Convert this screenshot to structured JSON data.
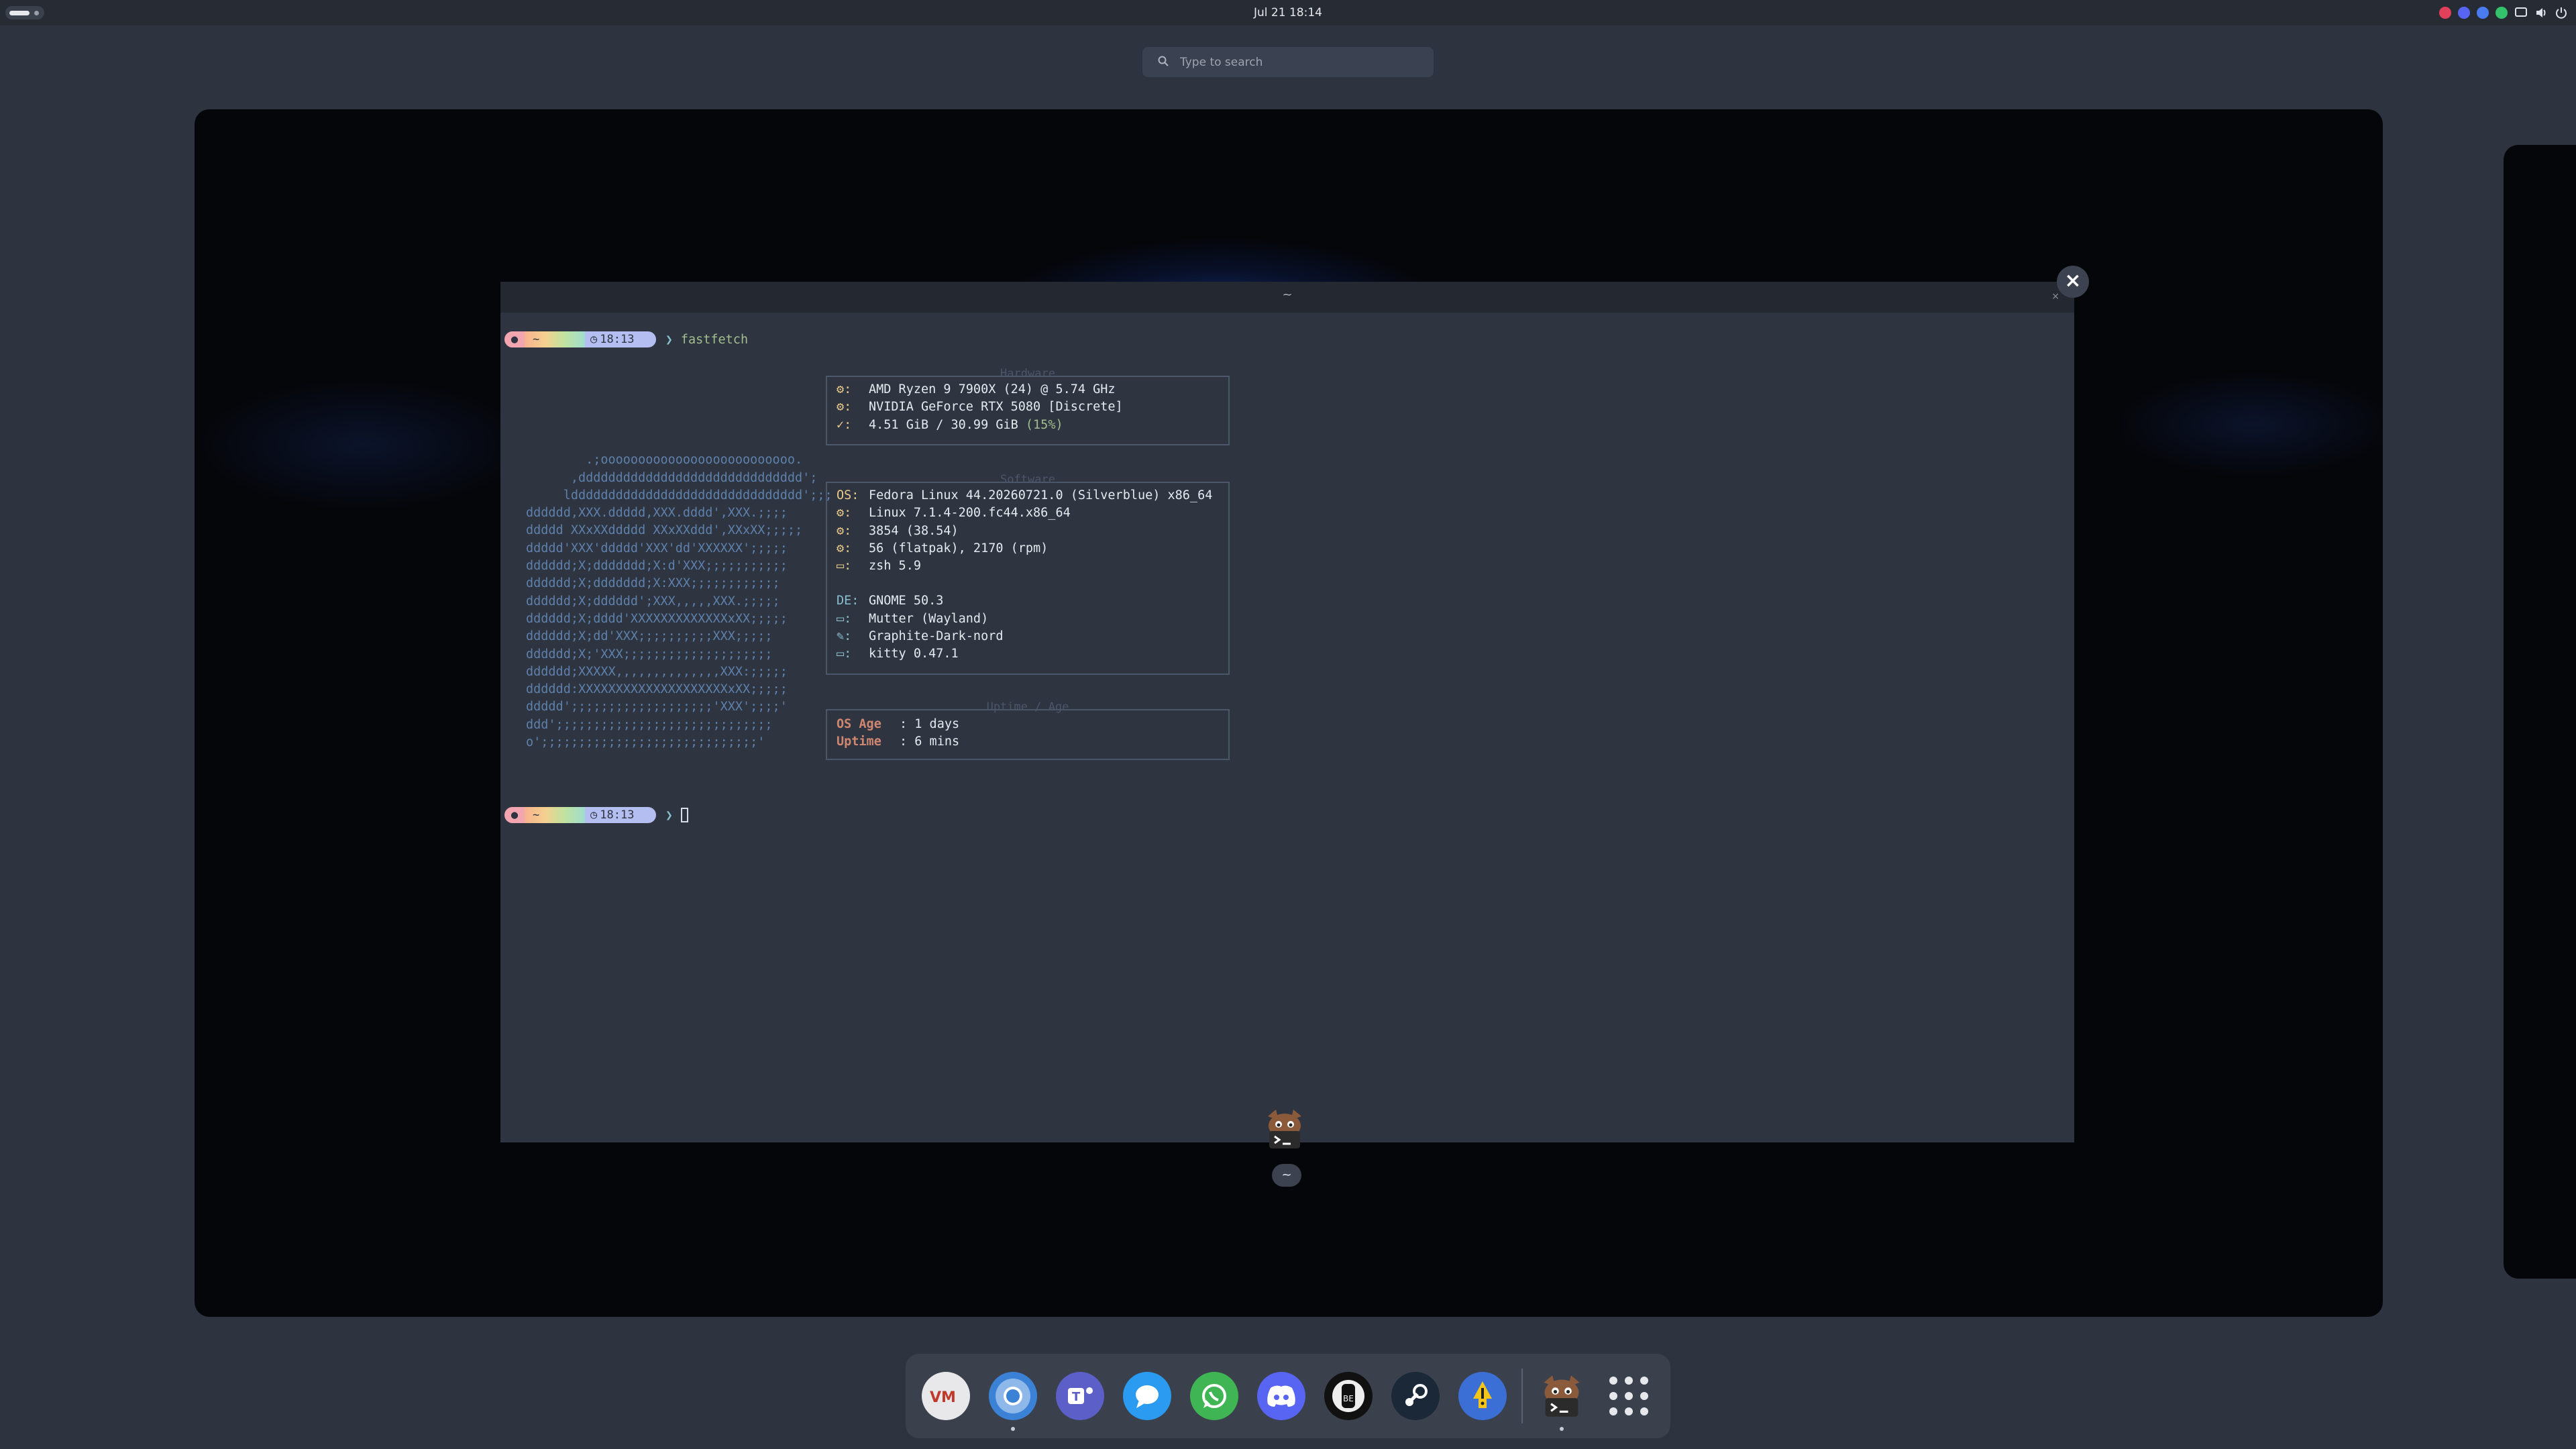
{
  "topbar": {
    "clock": "Jul 21  18:14",
    "tray_icons": [
      "record-icon",
      "discord-icon",
      "chat-icon",
      "whatsapp-icon",
      "screen-icon",
      "volume-icon",
      "power-icon"
    ]
  },
  "search": {
    "placeholder": "Type to search",
    "icon": "search-icon"
  },
  "terminal": {
    "title": "~",
    "prompt": {
      "dir": "~",
      "time": "18:13",
      "command": "fastfetch"
    },
    "logo_lines": [
      "        .;oooooooooooooooooooooooooo.",
      "      ,dddddddddddddddddddddddddddddd';",
      "     lddddddddddddddddddddddddddddddd';;;",
      "dddddd,XXX.ddddd,XXX.dddd',XXX.;;;;",
      "ddddd XXxXXddddd XXxXXddd',XXxXX;;;;;",
      "ddddd'XXX'ddddd'XXX'dd'XXXXXX';;;;;",
      "dddddd;X;ddddddd;X:d'XXX;;;;;;;;;;;",
      "dddddd;X;ddddddd;X:XXX;;;;;;;;;;;;",
      "dddddd;X;dddddd';XXX,,,,,XXX.;;;;;",
      "dddddd;X;dddd'XXXXXXXXXXXXXxXX;;;;;",
      "dddddd;X;dd'XXX;;;;;;;;;;XXX;;;;;",
      "dddddd;X;'XXX;;;;;;;;;;;;;;;;;;;;",
      "dddddd;XXXXX,,,,,,,,,,,,,,XXX:;;;;;",
      "dddddd:XXXXXXXXXXXXXXXXXXXXxXX;;;;;",
      "ddddd';;;;;;;;;;;;;;;;;;;'XXX';;;;'",
      "ddd';;;;;;;;;;;;;;;;;;;;;;;;;;;;;",
      "o';;;;;;;;;;;;;;;;;;;;;;;;;;;;;'"
    ],
    "hardware": {
      "caption": "Hardware",
      "rows": [
        {
          "key": "",
          "value": "AMD Ryzen 9 7900X (24) @ 5.74 GHz"
        },
        {
          "key": "",
          "value": "NVIDIA GeForce RTX 5080 [Discrete]"
        },
        {
          "key": "",
          "value": "4.51 GiB / 30.99 GiB ",
          "pct": "(15%)"
        }
      ]
    },
    "software": {
      "caption": "Software",
      "rows": [
        {
          "key": "OS",
          "value": "Fedora Linux 44.20260721.0 (Silverblue) x86_64"
        },
        {
          "key": "",
          "value": "Linux 7.1.4-200.fc44.x86_64"
        },
        {
          "key": "",
          "value": "3854 (38.54)"
        },
        {
          "key": "",
          "value": "56 (flatpak), 2170 (rpm)"
        },
        {
          "key": "",
          "value": "zsh 5.9"
        },
        {
          "key": "DE",
          "value": "GNOME 50.3"
        },
        {
          "key": "",
          "value": "Mutter (Wayland)"
        },
        {
          "key": "",
          "value": "Graphite-Dark-nord"
        },
        {
          "key": "",
          "value": "kitty 0.47.1"
        }
      ]
    },
    "uptime": {
      "caption": "Uptime / Age",
      "rows": [
        {
          "key": "OS Age",
          "value": ": 1 days"
        },
        {
          "key": "Uptime",
          "value": ": 6 mins"
        }
      ]
    }
  },
  "overview": {
    "window_label": "~"
  },
  "dock": {
    "apps": [
      "vmware-icon",
      "chromium-icon",
      "teams-icon",
      "messages-icon",
      "whatsapp-icon",
      "discord-icon",
      "heroic-icon",
      "steam-icon",
      "warning-app-icon",
      "kitty-icon"
    ],
    "show_apps": "app-grid-icon"
  }
}
